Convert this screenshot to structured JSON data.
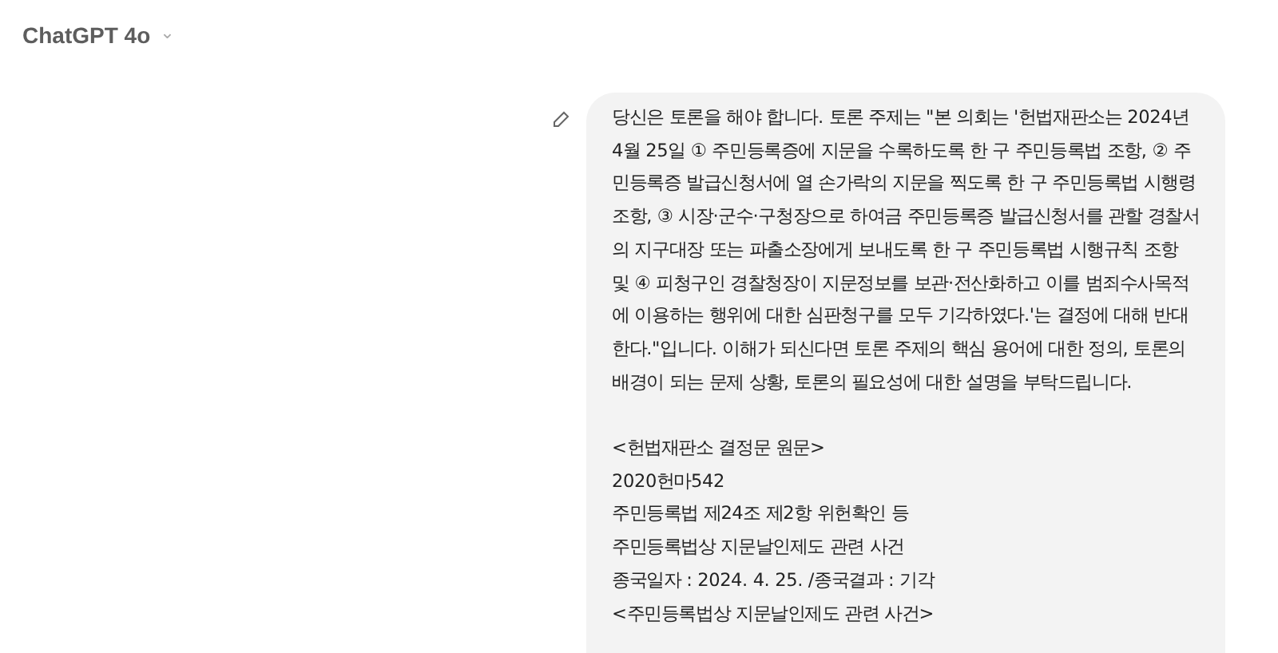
{
  "header": {
    "model_name": "ChatGPT 4o",
    "dropdown_caret": "⌄"
  },
  "message": {
    "paragraph": "당신은 토론을 해야 합니다. 토론 주제는 \"본 의회는 '헌법재판소는 2024년 4월 25일 ① 주민등록증에 지문을 수록하도록 한 구 주민등록법 조항, ② 주민등록증 발급신청서에 열 손가락의 지문을 찍도록 한 구 주민등록법 시행령 조항, ③ 시장·군수·구청장으로 하여금 주민등록증 발급신청서를 관할 경찰서의 지구대장 또는 파출소장에게 보내도록 한 구 주민등록법 시행규칙 조항 및 ④ 피청구인 경찰청장이 지문정보를 보관·전산화하고 이를 범죄수사목적에 이용하는 행위에 대한 심판청구를 모두 기각하였다.'는 결정에 대해 반대한다.\"입니다. 이해가 되신다면 토론 주제의 핵심 용어에 대한 정의, 토론의 배경이 되는 문제 상황, 토론의 필요성에 대한 설명을 부탁드립니다.",
    "lines": [
      "<헌법재판소 결정문 원문>",
      "2020헌마542",
      "주민등록법 제24조 제2항 위헌확인 등",
      "주민등록법상 지문날인제도 관련 사건",
      "종국일자 : 2024. 4. 25. /종국결과 : 기각",
      "<주민등록법상 지문날인제도 관련 사건>"
    ]
  }
}
